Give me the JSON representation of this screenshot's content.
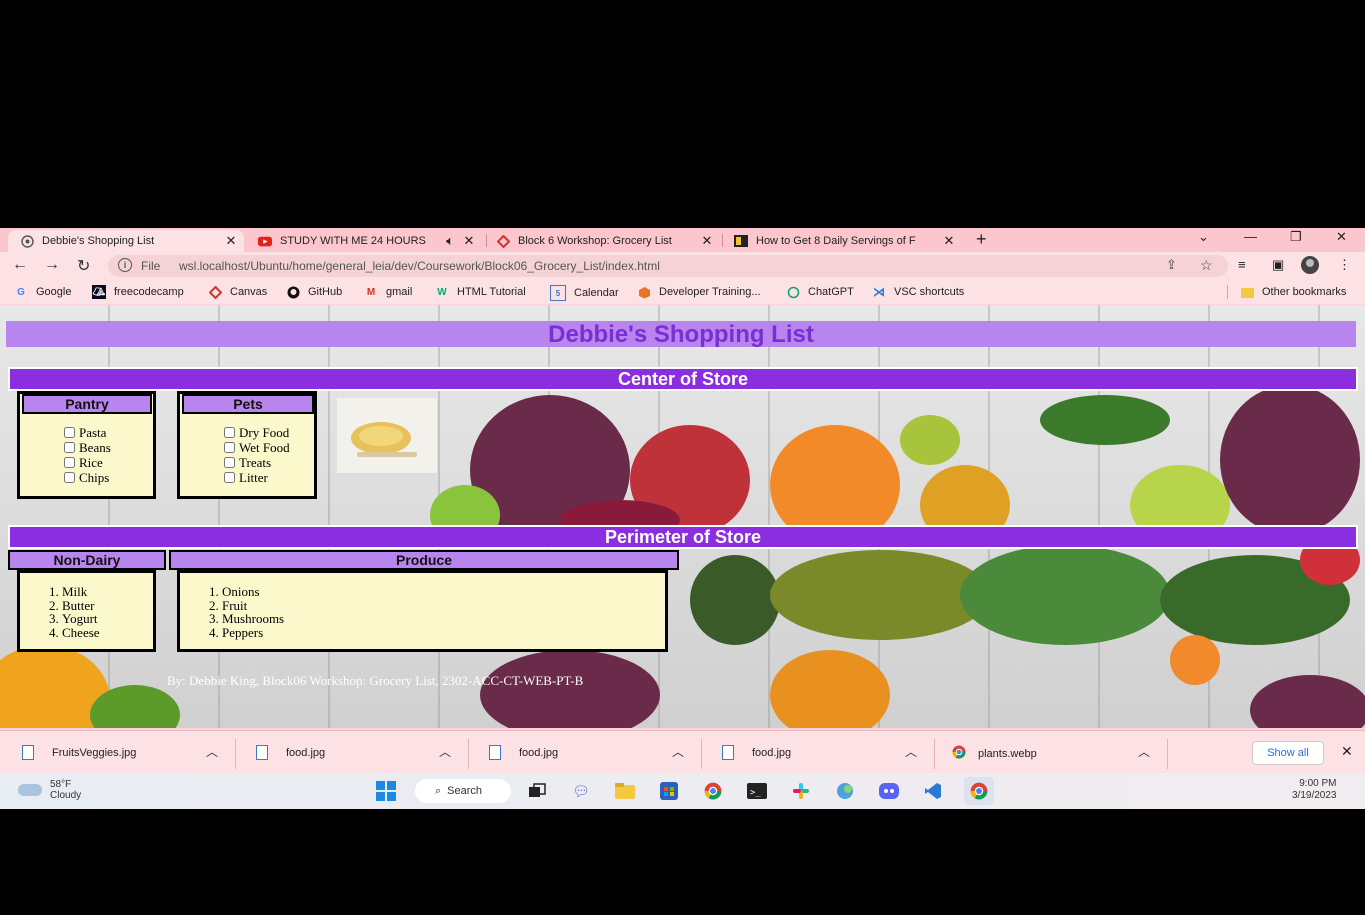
{
  "tabs": [
    {
      "title": "Debbie's Shopping List",
      "icon": "globe-icon",
      "active": true
    },
    {
      "title": "STUDY WITH ME 24 HOURS",
      "icon": "youtube-icon",
      "audio": true
    },
    {
      "title": "Block 6 Workshop: Grocery List",
      "icon": "canvas-icon"
    },
    {
      "title": "How to Get 8 Daily Servings of F",
      "icon": "article-icon"
    }
  ],
  "toolbar": {
    "file_label": "File",
    "url": "wsl.localhost/Ubuntu/home/general_leia/dev/Coursework/Block06_Grocery_List/index.html"
  },
  "bookmarks": [
    {
      "label": "Google",
      "icon": "google-icon"
    },
    {
      "label": "freecodecamp",
      "icon": "freecodecamp-icon"
    },
    {
      "label": "Canvas",
      "icon": "canvas-icon"
    },
    {
      "label": "GitHub",
      "icon": "github-icon"
    },
    {
      "label": "gmail",
      "icon": "gmail-icon"
    },
    {
      "label": "HTML Tutorial",
      "icon": "w3schools-icon"
    },
    {
      "label": "Calendar",
      "icon": "calendar-icon"
    },
    {
      "label": "Developer Training...",
      "icon": "box-icon"
    },
    {
      "label": "ChatGPT",
      "icon": "chatgpt-icon"
    },
    {
      "label": "VSC shortcuts",
      "icon": "vscode-icon"
    }
  ],
  "other_bookmarks": "Other bookmarks",
  "page": {
    "title": "Debbie's Shopping List",
    "center_heading": "Center of Store",
    "perimeter_heading": "Perimeter of Store",
    "pantry": {
      "heading": "Pantry",
      "items": [
        "Pasta",
        "Beans",
        "Rice",
        "Chips"
      ]
    },
    "pets": {
      "heading": "Pets",
      "items": [
        "Dry Food",
        "Wet Food",
        "Treats",
        "Litter"
      ]
    },
    "nondairy": {
      "heading": "Non-Dairy",
      "items": [
        "Milk",
        "Butter",
        "Yogurt",
        "Cheese"
      ]
    },
    "produce": {
      "heading": "Produce",
      "items": [
        "Onions",
        "Fruit",
        "Mushrooms",
        "Peppers"
      ]
    },
    "footer": "By: Debbie King, Block06 Workshop: Grocery List, 2302-ACC-CT-WEB-PT-B"
  },
  "downloads": [
    {
      "name": "FruitsVeggies.jpg"
    },
    {
      "name": "food.jpg"
    },
    {
      "name": "food.jpg"
    },
    {
      "name": "food.jpg"
    },
    {
      "name": "plants.webp"
    }
  ],
  "downloads_show_all": "Show all",
  "taskbar": {
    "temperature": "58°F",
    "condition": "Cloudy",
    "search_label": "Search",
    "time": "9:00 PM",
    "date": "3/19/2023"
  }
}
